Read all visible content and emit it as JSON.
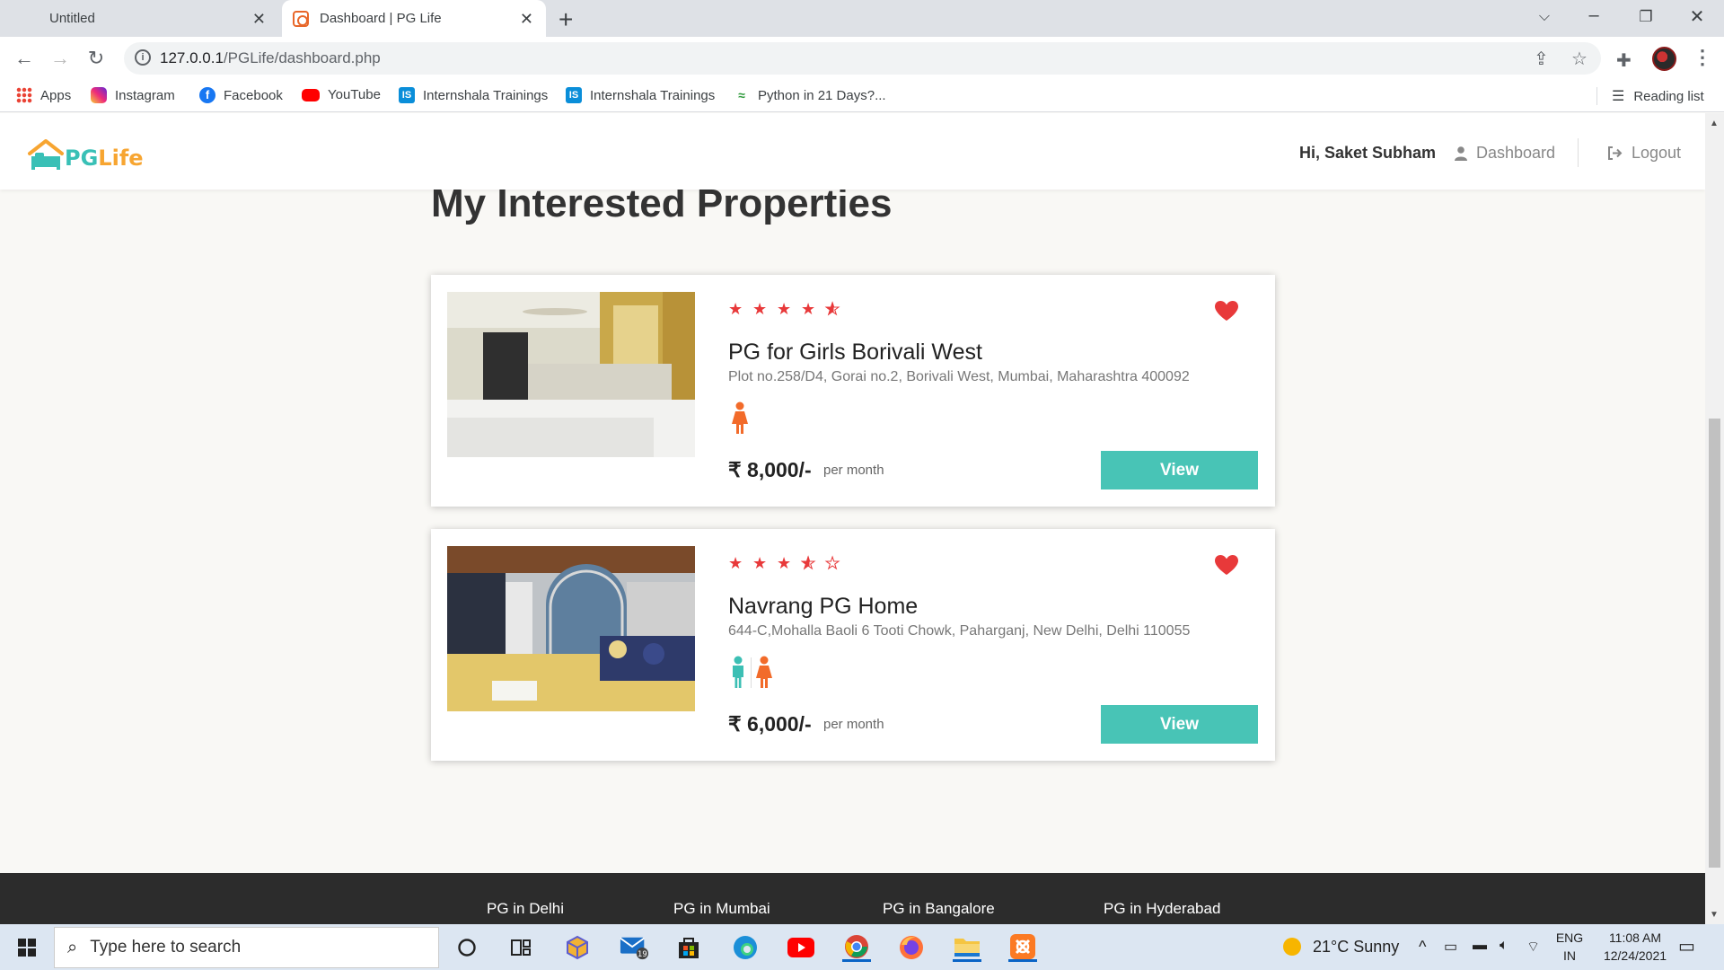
{
  "browser": {
    "tabs": [
      {
        "title": "Untitled",
        "active": false
      },
      {
        "title": "Dashboard | PG Life",
        "active": true
      }
    ],
    "url_host": "127.0.0.1",
    "url_path": "/PGLife/dashboard.php",
    "bookmarks": [
      {
        "label": "Apps",
        "icon": "apps-grid-icon"
      },
      {
        "label": "Instagram",
        "icon": "instagram-icon"
      },
      {
        "label": "Facebook",
        "icon": "facebook-icon"
      },
      {
        "label": "YouTube",
        "icon": "youtube-icon"
      },
      {
        "label": "Internshala Trainings",
        "icon": "internshala-icon"
      },
      {
        "label": "Internshala Trainings",
        "icon": "internshala-icon"
      },
      {
        "label": "Python in 21 Days?...",
        "icon": "python-icon"
      }
    ],
    "reading_list": "Reading list"
  },
  "site": {
    "logo_pg": "PG",
    "logo_life": "Life",
    "greeting": "Hi, Saket Subham",
    "nav": {
      "dashboard": "Dashboard",
      "logout": "Logout"
    },
    "page_title": "My Interested Properties",
    "properties": [
      {
        "name": "PG for Girls Borivali West",
        "address": "Plot no.258/D4, Gorai no.2, Borivali West, Mumbai, Maharashtra 400092",
        "rating": 4.5,
        "gender": [
          "female"
        ],
        "price": "₹ 8,000/-",
        "per": "per month",
        "view": "View",
        "interested": true
      },
      {
        "name": "Navrang PG Home",
        "address": "644-C,Mohalla Baoli 6 Tooti Chowk, Paharganj, New Delhi, Delhi 110055",
        "rating": 3.5,
        "gender": [
          "male",
          "female"
        ],
        "price": "₹ 6,000/-",
        "per": "per month",
        "view": "View",
        "interested": true
      }
    ],
    "footer_links": [
      "PG in Delhi",
      "PG in Mumbai",
      "PG in Bangalore",
      "PG in Hyderabad"
    ]
  },
  "taskbar": {
    "search_placeholder": "Type here to search",
    "mail_badge": "19",
    "weather": "21°C  Sunny",
    "lang_top": "ENG",
    "lang_bottom": "IN",
    "time": "11:08 AM",
    "date": "12/24/2021"
  },
  "colors": {
    "accent_teal": "#48c4b6",
    "star_red": "#e8393a",
    "female_orange": "#f26b2a",
    "male_teal": "#3cbfb4",
    "logo_orange": "#f7a531"
  }
}
